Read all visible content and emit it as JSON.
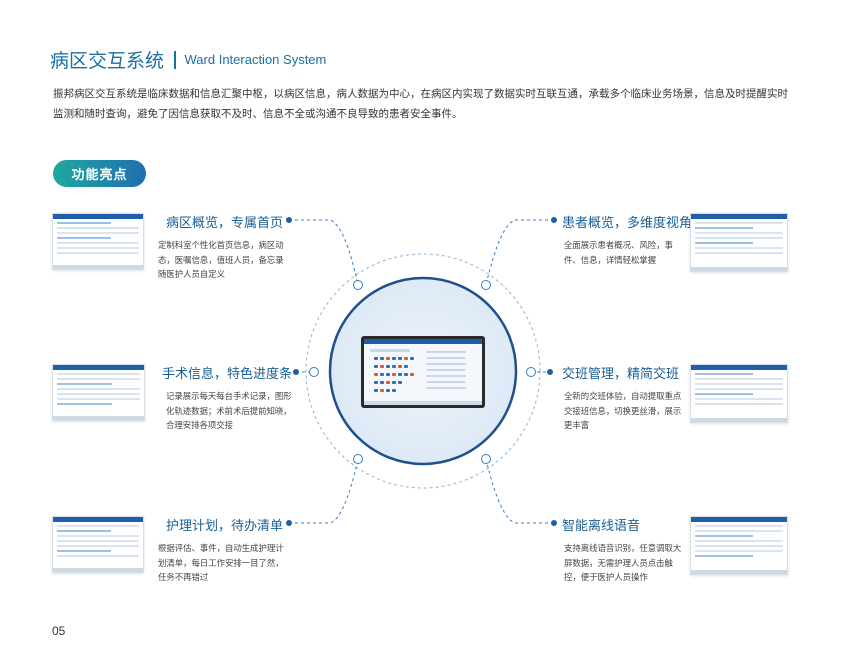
{
  "header": {
    "title_cn": "病区交互系统",
    "title_en": "Ward Interaction System"
  },
  "intro": "振邦病区交互系统是临床数据和信息汇聚中枢，以病区信息，病人数据为中心，在病区内实现了数据实时互联互通，承载多个临床业务场景，信息及时提醒实时监测和随时查询，避免了因信息获取不及时、信息不全或沟通不良导致的患者安全事件。",
  "badge": "功能亮点",
  "features": [
    {
      "title": "病区概览，专属首页",
      "desc": "定制科室个性化首页信息，病区动态，医嘱信息，值班人员，备忘录随医护人员自定义"
    },
    {
      "title": "患者概览，多维度视角",
      "desc": "全面展示患者概况、风险，事件、信息，详情轻松掌握"
    },
    {
      "title": "手术信息，特色进度条",
      "desc": "记录展示每天每台手术记录，图形化轨迹数据；术前术后提前知晓，合理安排各项交接"
    },
    {
      "title": "交班管理，精简交班",
      "desc": "全新的交班体验，自动提取重点交接班信息，切换更丝滑，展示更丰富"
    },
    {
      "title": "护理计划，待办清单",
      "desc": "根据评估、事件，自动生成护理计划清单，每日工作安排一目了然，任务不再错过"
    },
    {
      "title": "智能离线语音",
      "desc": "支持离线语音识别，任意调取大屏数据，无需护理人员点击触控，便于医护人员操作"
    }
  ],
  "colors": {
    "accent": "#1a6fa3",
    "badge_start": "#1fa89d",
    "badge_end": "#1f6fb0",
    "line": "#3a7cc0"
  },
  "footer": {
    "page_number": "05"
  }
}
